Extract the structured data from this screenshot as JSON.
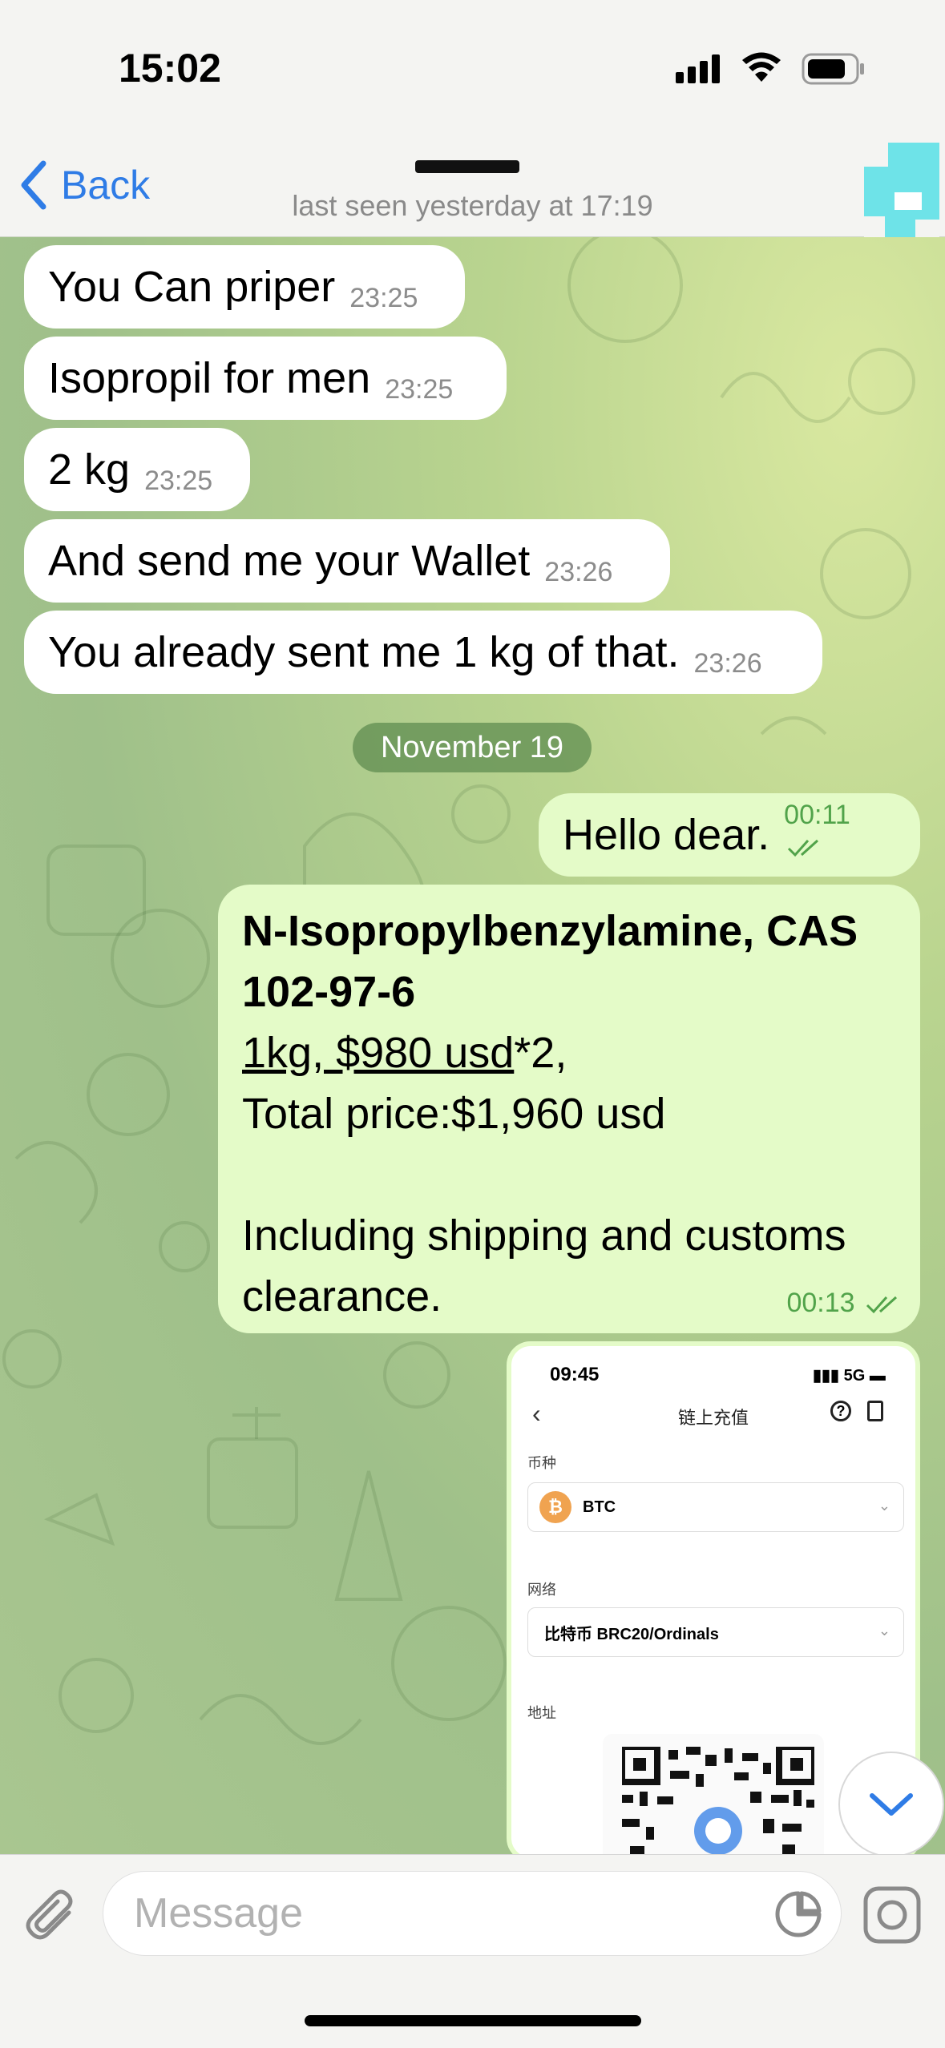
{
  "status_bar": {
    "time": "15:02"
  },
  "nav": {
    "back_label": "Back",
    "last_seen": "last seen yesterday at 17:19"
  },
  "messages": [
    {
      "direction": "incoming",
      "text": "You Can priper",
      "time": "23:25"
    },
    {
      "direction": "incoming",
      "text": "Isopropil for men",
      "time": "23:25"
    },
    {
      "direction": "incoming",
      "text": "2 kg",
      "time": "23:25"
    },
    {
      "direction": "incoming",
      "text": "And send me your Wallet",
      "time": "23:26"
    },
    {
      "direction": "incoming",
      "text": "You already sent me 1 kg of that.",
      "time": "23:26"
    },
    {
      "direction": "outgoing",
      "text": "Hello dear.",
      "time": "00:11"
    }
  ],
  "date_separator": "November 19",
  "product_message": {
    "title": "N-Isopropylbenzylamine, CAS 102-97-6",
    "price_underlined": "1kg, $980 usd",
    "price_suffix": "*2,",
    "total": "Total price:$1,960 usd",
    "shipping": "Including shipping and customs clearance.",
    "time": "00:13"
  },
  "image_message": {
    "phone_time": "09:45",
    "phone_status": "5G",
    "screen_title": "链上充值",
    "coin_label": "币种",
    "coin_value": "BTC",
    "coin_symbol": "₿",
    "network_label": "网络",
    "network_value": "比特币 BRC20/Ordinals",
    "address_label": "地址"
  },
  "input": {
    "placeholder": "Message"
  },
  "colors": {
    "accent": "#2f7ce6",
    "outgoing_bubble": "#e4fbc8",
    "incoming_bubble": "#ffffff",
    "outgoing_time": "#51a34a"
  }
}
